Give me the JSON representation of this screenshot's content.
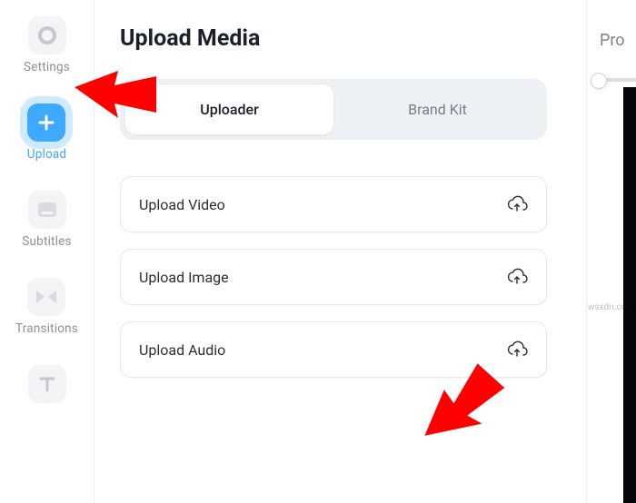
{
  "rail": {
    "items": [
      {
        "label": "Settings",
        "icon": "record-icon",
        "active": false
      },
      {
        "label": "Upload",
        "icon": "plus-icon",
        "active": true
      },
      {
        "label": "Subtitles",
        "icon": "screen-icon",
        "active": false
      },
      {
        "label": "Transitions",
        "icon": "transition-icon",
        "active": false
      },
      {
        "label": "",
        "icon": "text-icon",
        "active": false
      }
    ]
  },
  "panel": {
    "title": "Upload Media",
    "tabs": {
      "uploader": "Uploader",
      "brand_kit": "Brand Kit"
    },
    "uploads": [
      {
        "label": "Upload Video"
      },
      {
        "label": "Upload Image"
      },
      {
        "label": "Upload Audio"
      }
    ]
  },
  "right": {
    "label": "Pro"
  },
  "watermark": "wsxdn.com"
}
